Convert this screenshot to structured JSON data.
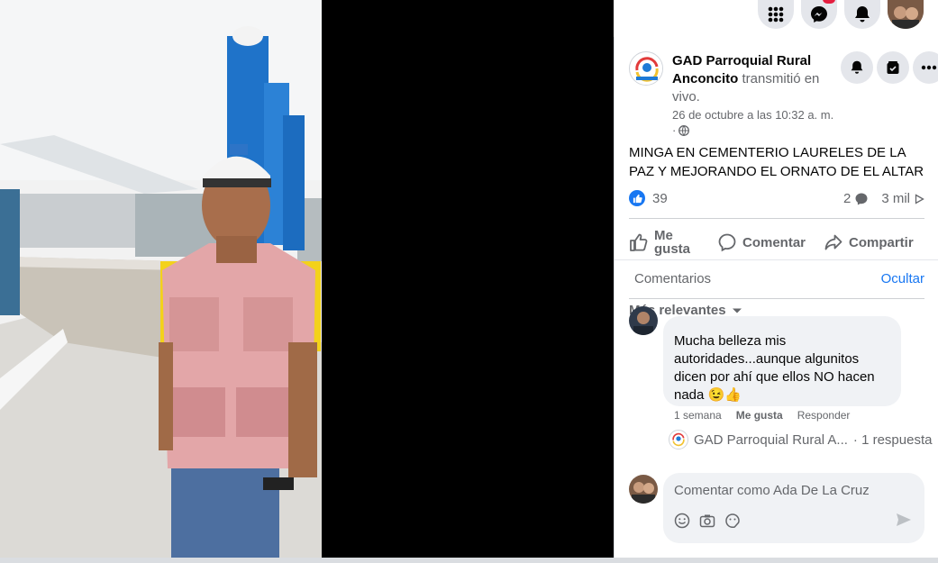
{
  "post": {
    "page_name": "GAD Parroquial Rural Anconcito",
    "action_text": "transmitió en vivo.",
    "date": "26 de octubre a las 10:32 a. m.",
    "privacy_prefix": "·",
    "text": "MINGA EN CEMENTERIO LAURELES DE LA PAZ Y MEJORANDO EL ORNATO DE EL ALTAR"
  },
  "stats": {
    "likes": "39",
    "comments": "2",
    "views": "3 mil"
  },
  "actions": {
    "like": "Me gusta",
    "comment": "Comentar",
    "share": "Compartir"
  },
  "comments_section": {
    "label": "Comentarios",
    "hide": "Ocultar",
    "sort": "Más relevantes"
  },
  "comment": {
    "text": "Mucha belleza mis autoridades...aunque algunitos dicen por ahí que ellos NO hacen nada",
    "emojis": "😉👍",
    "time": "1 semana",
    "like": "Me gusta",
    "reply": "Responder"
  },
  "reply_summary": {
    "author": "GAD Parroquial Rural A...",
    "count": "· 1 respuesta"
  },
  "composer": {
    "placeholder": "Comentar como Ada De La Cruz"
  },
  "icons": [
    "menu-grid-icon",
    "messenger-icon",
    "bell-icon",
    "notify-bell-icon",
    "saved-icon",
    "more-icon",
    "like-icon",
    "comment-icon",
    "share-icon",
    "chevron-down-icon",
    "globe-icon",
    "emoji-icon",
    "camera-icon",
    "sticker-icon",
    "send-icon"
  ],
  "colors": {
    "accent": "#1877f2",
    "badge": "#e41e3f",
    "muted": "#65676b"
  }
}
